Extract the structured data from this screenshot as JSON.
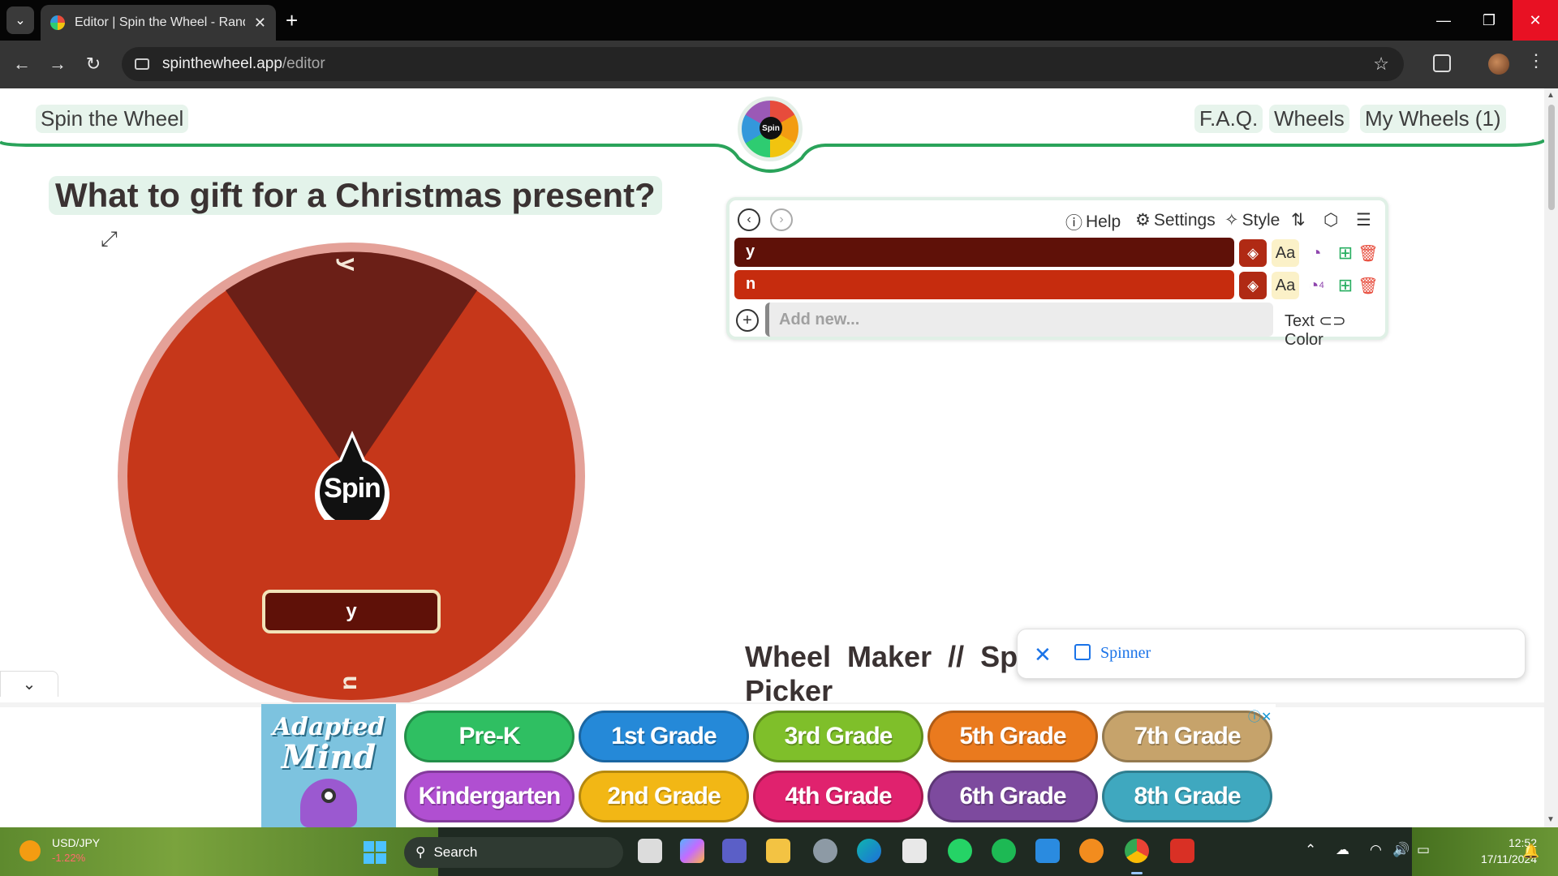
{
  "browser": {
    "tab_title": "Editor | Spin the Wheel - Rando",
    "url_host": "spinthewheel.app",
    "url_path": "/editor"
  },
  "header": {
    "brand": "Spin the Wheel",
    "logo_text": "Spin",
    "nav": [
      "F.A.Q.",
      "Wheels",
      "My Wheels (1)"
    ]
  },
  "wheel": {
    "title": "What to gift for a Christmas present?",
    "spin_label": "Spin",
    "result": "y",
    "segments": [
      {
        "label": "y",
        "color": "#6b1f17"
      },
      {
        "label": "n",
        "color": "#c6371a"
      }
    ],
    "rim_color": "#e4a198"
  },
  "editor": {
    "tools": [
      "Help",
      "Settings",
      "Style"
    ],
    "entries": [
      {
        "text": "y",
        "color": "#5f1108"
      },
      {
        "text": "n",
        "color": "#c62c0e"
      }
    ],
    "font_button": "Aa",
    "weight_badge": "4",
    "add_placeholder": "Add new...",
    "toggle_left": "Text",
    "toggle_right": "Color"
  },
  "section_heading": "Wheel Maker // Sp Picker",
  "shop_popup": {
    "label": "Spinner"
  },
  "ad": {
    "brand_line1": "Adapted",
    "brand_line2": "Mind",
    "grades": [
      {
        "label": "Pre-K",
        "color": "#2fbf62"
      },
      {
        "label": "1st Grade",
        "color": "#2589d8"
      },
      {
        "label": "3rd Grade",
        "color": "#7fbf2a"
      },
      {
        "label": "5th Grade",
        "color": "#ea7a1e"
      },
      {
        "label": "7th Grade",
        "color": "#c6a36b"
      },
      {
        "label": "Kindergarten",
        "color": "#b04fd1"
      },
      {
        "label": "2nd Grade",
        "color": "#f2b715"
      },
      {
        "label": "4th Grade",
        "color": "#e0226e"
      },
      {
        "label": "6th Grade",
        "color": "#7d4a9e"
      },
      {
        "label": "8th Grade",
        "color": "#3fa8bf"
      }
    ]
  },
  "taskbar": {
    "ticker_name": "USD/JPY",
    "ticker_change": "-1.22%",
    "search_label": "Search",
    "time": "12:52",
    "date": "17/11/2024"
  }
}
